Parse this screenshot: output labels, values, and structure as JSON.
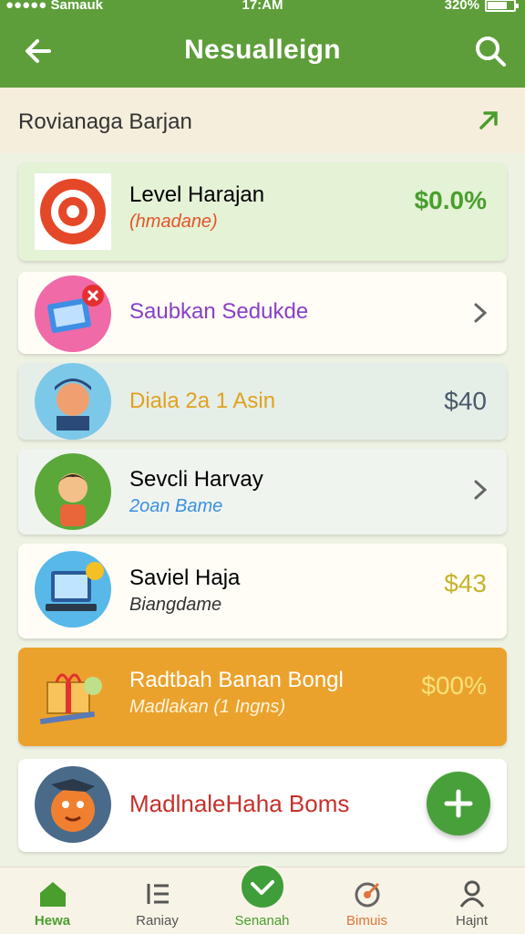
{
  "status_bar": {
    "carrier": "●●●●● Samauk",
    "time": "17:AM",
    "battery": "320%"
  },
  "app_bar": {
    "title": "Nesualleign",
    "back_icon": "back-arrow-icon",
    "search_icon": "search-icon"
  },
  "section": {
    "label": "Rovianaga Barjan",
    "arrow_icon": "arrow-up-right-icon"
  },
  "items": [
    {
      "title": "Level Harajan",
      "subtitle": "(hmadane)",
      "price": "$0.0%",
      "icon": "target-icon",
      "title_color": "#222222",
      "subtitle_color": "#e5542a",
      "price_color": "#4a9e2e"
    },
    {
      "title": "Saubkan Sedukde",
      "subtitle": "",
      "price": "",
      "icon": "photo-frame-icon",
      "title_color": "#8a3fc6",
      "title_color2": "#3a90e0"
    },
    {
      "title": "Diala 2a 1 Asin",
      "subtitle": "",
      "price": "$40",
      "icon": "person-icon",
      "title_color": "#e0a11f",
      "price_color": "#4a5a6a"
    },
    {
      "title": "Sevcli Harvay",
      "subtitle": "2oan Bame",
      "price": "",
      "icon": "kid-icon",
      "title_color": "#222222",
      "subtitle_color": "#3a90e0"
    },
    {
      "title": "Saviel Haja",
      "subtitle": "Biangdame",
      "price": "$43",
      "icon": "laptop-icon",
      "title_color": "#222222",
      "subtitle_color": "#333333",
      "price_color": "#c6b32a"
    },
    {
      "title": "Radtbah Banan Bongl",
      "subtitle": "Madlakan (1 Ingns)",
      "price": "$00%",
      "icon": "gift-box-icon",
      "title_color": "#ffffff",
      "subtitle_color": "#fff4dc",
      "price_color": "#f7e27a"
    },
    {
      "title": "MadlnaleHaha Boms",
      "subtitle": "",
      "price": "",
      "icon": "mascot-icon",
      "title_color": "#c7302a"
    }
  ],
  "fab": {
    "icon": "plus-icon"
  },
  "bottom_nav": [
    {
      "label": "Hewa",
      "icon": "home-icon",
      "color": "#4a9e2e"
    },
    {
      "label": "Raniay",
      "icon": "list-icon",
      "color": "#555555"
    },
    {
      "label": "Senanah",
      "icon": "check-icon",
      "color": "#4a9e2e"
    },
    {
      "label": "Bimuis",
      "icon": "target-icon",
      "color": "#e0743a"
    },
    {
      "label": "Hajnt",
      "icon": "profile-icon",
      "color": "#555555"
    }
  ]
}
